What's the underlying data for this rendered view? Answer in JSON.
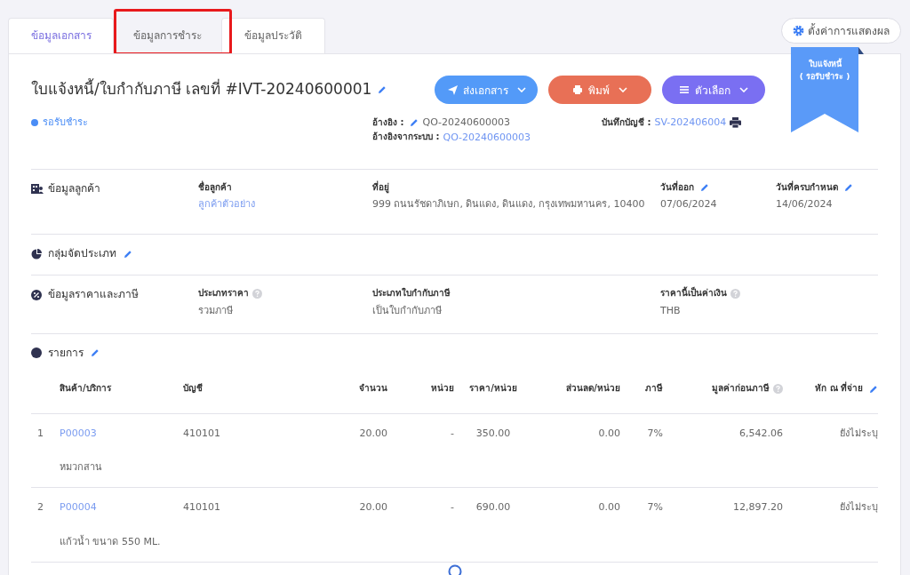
{
  "tabs": [
    {
      "label": "ข้อมูลเอกสาร",
      "selected": true,
      "highlighted": false
    },
    {
      "label": "ข้อมูลการชำระ",
      "selected": false,
      "highlighted": true
    },
    {
      "label": "ข้อมูลประวัติ",
      "selected": false,
      "highlighted": false
    }
  ],
  "display_settings_button": {
    "label": "ตั้งค่าการแสดงผล"
  },
  "ribbon": {
    "title": "ใบแจ้งหนี้",
    "status": "( รอรับชำระ )"
  },
  "document": {
    "title": "ใบแจ้งหนี้/ใบกำกับภาษี เลขที่ #IVT-20240600001",
    "editable": true,
    "actions": [
      {
        "kind": "send",
        "label": "ส่งเอกสาร"
      },
      {
        "kind": "print",
        "label": "พิมพ์"
      },
      {
        "kind": "options",
        "label": "ตัวเลือก"
      }
    ],
    "status": {
      "label": "รอรับชำระ",
      "color": "#4a8df6"
    },
    "reference": {
      "label": "อ้างอิง :",
      "value": "QO-20240600003"
    },
    "system_reference": {
      "label": "อ้างอิงจากระบบ :",
      "value": "QO-20240600003"
    },
    "accounting": {
      "label": "บันทึกบัญชี :",
      "value": "SV-202406004"
    }
  },
  "sections": [
    {
      "kind": "customer",
      "title": "ข้อมูลลูกค้า",
      "editable": false,
      "fields": [
        {
          "label": "ชื่อลูกค้า",
          "value": "ลูกค้าตัวอย่าง",
          "link": true,
          "editable": false,
          "help": false
        },
        {
          "label": "ที่อยู่",
          "value": "999 ถนนรัชดาภิเษก, ดินแดง, ดินแดง, กรุงเทพมหานคร, 10400",
          "link": false,
          "editable": false,
          "help": false
        },
        {
          "label": "วันที่ออก",
          "value": "07/06/2024",
          "link": false,
          "editable": true,
          "help": false
        },
        {
          "label": "วันที่ครบกำหนด",
          "value": "14/06/2024",
          "link": false,
          "editable": true,
          "help": false
        }
      ]
    },
    {
      "kind": "group",
      "title": "กลุ่มจัดประเภท",
      "editable": true
    },
    {
      "kind": "price",
      "title": "ข้อมูลราคาและภาษี",
      "editable": false,
      "fields": [
        {
          "label": "ประเภทราคา",
          "value": "รวมภาษี",
          "link": false,
          "editable": false,
          "help": true
        },
        {
          "label": "ประเภทใบกำกับภาษี",
          "value": "เป็นใบกำกับภาษี",
          "link": false,
          "editable": false,
          "help": false
        },
        {
          "label": "ราคานี้เป็นค่าเงิน",
          "value": "THB",
          "link": false,
          "editable": false,
          "help": true
        }
      ]
    },
    {
      "kind": "items",
      "title": "รายการ",
      "editable": true
    }
  ],
  "table": {
    "columns": [
      {
        "label": "สินค้า/บริการ",
        "help": false,
        "editable": false
      },
      {
        "label": "บัญชี",
        "help": false,
        "editable": false
      },
      {
        "label": "จำนวน",
        "help": false,
        "editable": false
      },
      {
        "label": "หน่วย",
        "help": false,
        "editable": false
      },
      {
        "label": "ราคา/หน่วย",
        "help": false,
        "editable": false
      },
      {
        "label": "ส่วนลด/หน่วย",
        "help": false,
        "editable": false
      },
      {
        "label": "ภาษี",
        "help": false,
        "editable": false
      },
      {
        "label": "มูลค่าก่อนภาษี",
        "help": true,
        "editable": false
      },
      {
        "label": "หัก ณ ที่จ่าย",
        "help": false,
        "editable": true
      }
    ],
    "rows": [
      {
        "index": "1",
        "product": "P00003",
        "description": "หมวกสาน",
        "account": "410101",
        "quantity": "20.00",
        "unit": "-",
        "price": "350.00",
        "discount": "0.00",
        "tax": "7%",
        "amount": "6,542.06",
        "withholding": "ยังไม่ระบุ"
      },
      {
        "index": "2",
        "product": "P00004",
        "description": "แก้วน้ำ ขนาด 550 ML.",
        "account": "410101",
        "quantity": "20.00",
        "unit": "-",
        "price": "690.00",
        "discount": "0.00",
        "tax": "7%",
        "amount": "12,897.20",
        "withholding": "ยังไม่ระบุ"
      }
    ]
  }
}
